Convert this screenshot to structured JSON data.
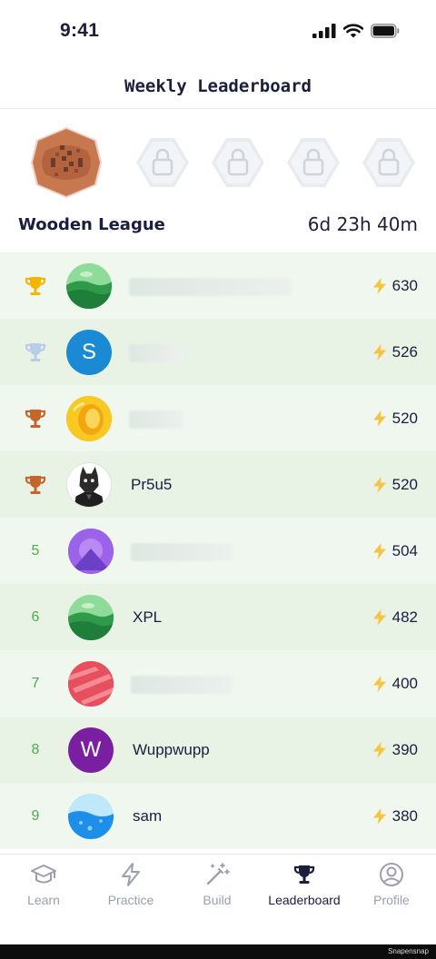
{
  "status_bar": {
    "time": "9:41"
  },
  "header": {
    "title": "Weekly Leaderboard"
  },
  "league": {
    "name": "Wooden League",
    "countdown": "6d 23h 40m",
    "badges": [
      {
        "state": "current",
        "icon": "wooden-league-badge-icon"
      },
      {
        "state": "locked",
        "icon": "lock-icon"
      },
      {
        "state": "locked",
        "icon": "lock-icon"
      },
      {
        "state": "locked",
        "icon": "lock-icon"
      },
      {
        "state": "locked",
        "icon": "lock-icon"
      }
    ]
  },
  "leaderboard": {
    "rows": [
      {
        "rank": "",
        "trophy": "gold",
        "avatar": "green-landscape",
        "avatar_letter": "",
        "name": "",
        "name_hidden": true,
        "score": "630"
      },
      {
        "rank": "",
        "trophy": "silver",
        "avatar": "letter",
        "avatar_letter": "S",
        "avatar_color": "#1a8ad4",
        "name": "",
        "name_hidden": true,
        "score": "526"
      },
      {
        "rank": "",
        "trophy": "bronze",
        "avatar": "gold-coin",
        "avatar_letter": "",
        "name": "",
        "name_hidden": true,
        "score": "520"
      },
      {
        "rank": "",
        "trophy": "bronze",
        "avatar": "wolf",
        "avatar_letter": "",
        "name": "Pr5u5",
        "name_hidden": false,
        "score": "520"
      },
      {
        "rank": "5",
        "trophy": "",
        "avatar": "purple-mountain",
        "avatar_letter": "",
        "name": "",
        "name_hidden": true,
        "score": "504"
      },
      {
        "rank": "6",
        "trophy": "",
        "avatar": "green-landscape",
        "avatar_letter": "",
        "name": "XPL",
        "name_hidden": false,
        "score": "482"
      },
      {
        "rank": "7",
        "trophy": "",
        "avatar": "red-stripes",
        "avatar_letter": "",
        "name": "",
        "name_hidden": true,
        "score": "400"
      },
      {
        "rank": "8",
        "trophy": "",
        "avatar": "letter",
        "avatar_letter": "W",
        "avatar_color": "#7b1fa2",
        "name": "Wuppwupp",
        "name_hidden": false,
        "score": "390"
      },
      {
        "rank": "9",
        "trophy": "",
        "avatar": "blue-water",
        "avatar_letter": "",
        "name": "sam",
        "name_hidden": false,
        "score": "380"
      }
    ]
  },
  "tab_bar": {
    "tabs": [
      {
        "label": "Learn",
        "icon": "graduation-cap-icon",
        "active": false
      },
      {
        "label": "Practice",
        "icon": "lightning-icon",
        "active": false
      },
      {
        "label": "Build",
        "icon": "magic-wand-icon",
        "active": false
      },
      {
        "label": "Leaderboard",
        "icon": "trophy-icon",
        "active": true
      },
      {
        "label": "Profile",
        "icon": "user-circle-icon",
        "active": false
      }
    ]
  },
  "footer": {
    "text": "Snapensnap"
  },
  "colors": {
    "text": "#1b1e3c",
    "rank_green": "#4cae4c",
    "bolt": "#f6c445",
    "gold": "#f4b400",
    "silver": "#b8cde8",
    "bronze": "#c4652b",
    "row_light": "#f0f7ef",
    "row_dark": "#e8f3e6"
  }
}
